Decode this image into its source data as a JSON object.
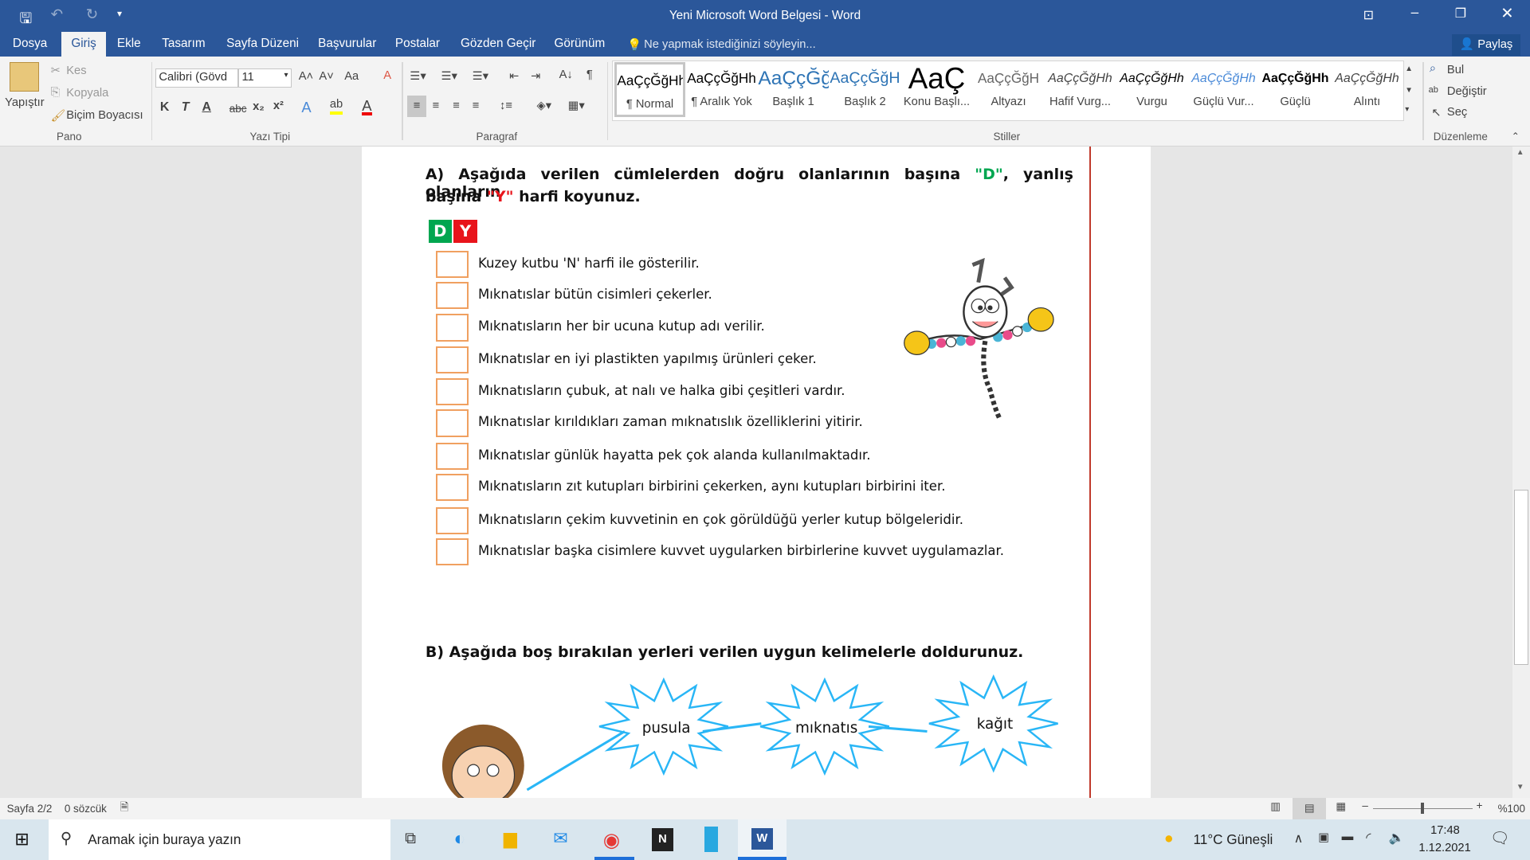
{
  "window": {
    "title": "Yeni Microsoft Word Belgesi - Word",
    "share": "Paylaş"
  },
  "tabs": [
    "Dosya",
    "Giriş",
    "Ekle",
    "Tasarım",
    "Sayfa Düzeni",
    "Başvurular",
    "Postalar",
    "Gözden Geçir",
    "Görünüm"
  ],
  "tell_me": "Ne yapmak istediğinizi söyleyin...",
  "clipboard": {
    "paste": "Yapıştır",
    "cut": "Kes",
    "copy": "Kopyala",
    "format_painter": "Biçim Boyacısı",
    "label": "Pano"
  },
  "font": {
    "name": "Calibri (Gövd",
    "size": "11",
    "label": "Yazı Tipi",
    "bold": "K",
    "italic": "T",
    "underline": "A",
    "strike": "abc",
    "case": "Aa"
  },
  "paragraph": {
    "label": "Paragraf"
  },
  "styles": {
    "label": "Stiller",
    "items": [
      {
        "sample": "AaÇçĞğHh",
        "name": "¶ Normal"
      },
      {
        "sample": "AaÇçĞğHh",
        "name": "¶ Aralık Yok"
      },
      {
        "sample": "AaÇçĞğ",
        "name": "Başlık 1"
      },
      {
        "sample": "AaÇçĞğH",
        "name": "Başlık 2"
      },
      {
        "sample": "AaÇ",
        "name": "Konu Başlı..."
      },
      {
        "sample": "AaÇçĞğH",
        "name": "Altyazı"
      },
      {
        "sample": "AaÇçĞğHh",
        "name": "Hafif Vurg..."
      },
      {
        "sample": "AaÇçĞğHh",
        "name": "Vurgu"
      },
      {
        "sample": "AaÇçĞğHh",
        "name": "Güçlü Vur..."
      },
      {
        "sample": "AaÇçĞğHh",
        "name": "Güçlü"
      },
      {
        "sample": "AaÇçĞğHh",
        "name": "Alıntı"
      }
    ]
  },
  "editing": {
    "find": "Bul",
    "replace": "Değiştir",
    "select": "Seç",
    "label": "Düzenleme"
  },
  "document": {
    "section_a": {
      "p1": "A) Aşağıda verilen cümlelerden doğru olanlarının başına ",
      "d": "\"D\"",
      "p2": ", yanlış olanların",
      "p3": "başına ",
      "y": "\"Y\"",
      "p4": " harfi koyunuz."
    },
    "d_label": "D",
    "y_label": "Y",
    "items": [
      "Kuzey kutbu 'N' harfi ile gösterilir.",
      "Mıknatıslar bütün cisimleri çekerler.",
      "Mıknatısların her bir ucuna kutup adı verilir.",
      "Mıknatıslar en iyi plastikten yapılmış ürünleri çeker.",
      "Mıknatısların çubuk, at nalı ve halka gibi çeşitleri vardır.",
      "Mıknatıslar kırıldıkları zaman mıknatıslık özelliklerini yitirir.",
      "Mıknatıslar günlük hayatta pek çok alanda kullanılmaktadır.",
      "Mıknatısların zıt kutupları birbirini çekerken, aynı kutupları birbirini iter.",
      "Mıknatısların çekim kuvvetinin en çok görüldüğü yerler kutup bölgeleridir.",
      "Mıknatıslar başka cisimlere kuvvet uygularken birbirlerine kuvvet uygulamazlar."
    ],
    "section_b": "B) Aşağıda boş bırakılan yerleri verilen uygun kelimelerle doldurunuz.",
    "words": [
      "pusula",
      "mıknatıs",
      "kağıt"
    ]
  },
  "status": {
    "page": "Sayfa 2/2",
    "words": "0 sözcük",
    "zoom": "%100",
    "zoom_level": 100
  },
  "taskbar": {
    "search": "Aramak için buraya yazın",
    "weather": "11°C  Güneşli",
    "time": "17:48",
    "date": "1.12.2021"
  },
  "colors": {
    "brand": "#2b579a",
    "d": "#00a650",
    "y": "#e8141b",
    "checkbox": "#f0a060",
    "burst": "#29b6f6"
  }
}
